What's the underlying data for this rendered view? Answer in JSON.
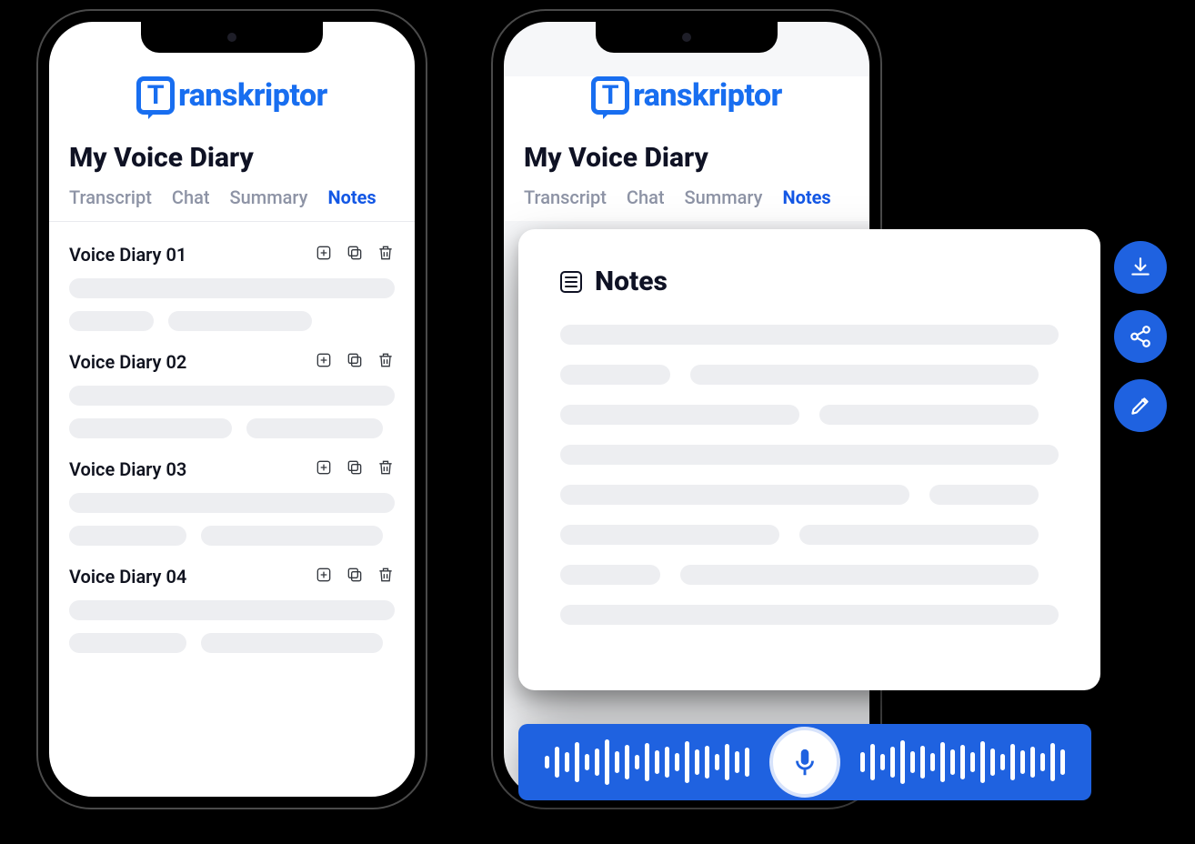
{
  "brand": {
    "mark_letter": "T",
    "name": "ranskriptor"
  },
  "colors": {
    "accent": "#1f62e0",
    "text": "#0f1224",
    "muted": "#8d93a5"
  },
  "left": {
    "title": "My Voice Diary",
    "tabs": [
      {
        "label": "Transcript",
        "active": false
      },
      {
        "label": "Chat",
        "active": false
      },
      {
        "label": "Summary",
        "active": false
      },
      {
        "label": "Notes",
        "active": true
      }
    ],
    "items": [
      {
        "title": "Voice Diary 01"
      },
      {
        "title": "Voice Diary 02"
      },
      {
        "title": "Voice Diary 03"
      },
      {
        "title": "Voice Diary 04"
      }
    ],
    "item_action_icons": [
      "add-note-icon",
      "copy-icon",
      "delete-icon"
    ]
  },
  "right": {
    "title": "My Voice Diary",
    "tabs": [
      {
        "label": "Transcript",
        "active": false
      },
      {
        "label": "Chat",
        "active": false
      },
      {
        "label": "Summary",
        "active": false
      },
      {
        "label": "Notes",
        "active": true
      }
    ]
  },
  "notes_card": {
    "title": "Notes"
  },
  "fab_icons": [
    "download-icon",
    "share-icon",
    "edit-icon"
  ]
}
